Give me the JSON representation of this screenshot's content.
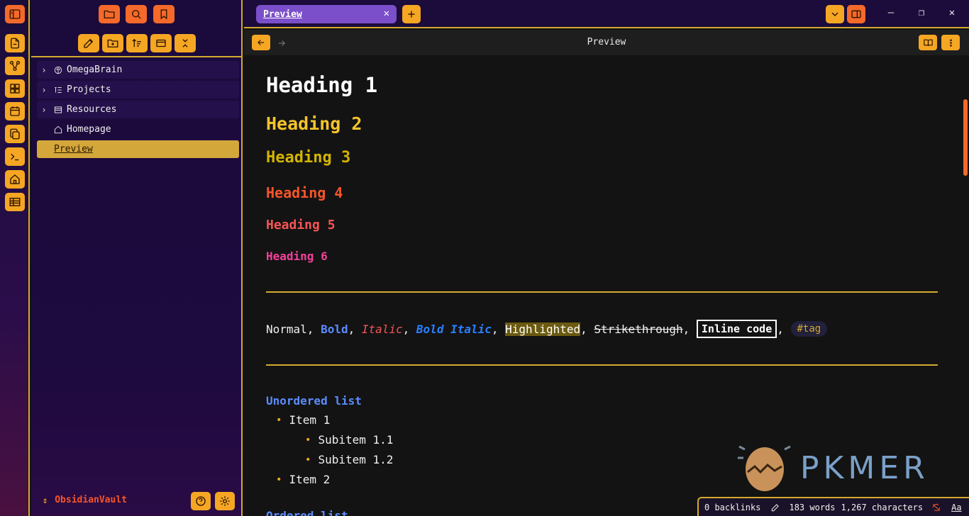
{
  "ribbon": {
    "items": [
      {
        "name": "toggle-sidebar-icon"
      },
      {
        "name": "new-note-icon"
      },
      {
        "name": "graph-view-icon"
      },
      {
        "name": "dashboard-icon"
      },
      {
        "name": "calendar-icon"
      },
      {
        "name": "copy-icon"
      },
      {
        "name": "terminal-icon"
      },
      {
        "name": "home-icon"
      },
      {
        "name": "table-icon"
      }
    ]
  },
  "sidebar": {
    "top_icons": [
      "folder-icon",
      "search-icon",
      "bookmark-icon"
    ],
    "actions": [
      "new-note-icon",
      "new-folder-icon",
      "sort-icon",
      "collapse-view-icon",
      "close-icon"
    ],
    "tree": [
      {
        "label": "OmegaBrain",
        "icon": "brain-icon",
        "expandable": true
      },
      {
        "label": "Projects",
        "icon": "list-tree-icon",
        "expandable": true
      },
      {
        "label": "Resources",
        "icon": "library-icon",
        "expandable": true
      },
      {
        "label": "Homepage",
        "icon": "home-icon",
        "expandable": false
      },
      {
        "label": "Preview",
        "icon": "",
        "expandable": false,
        "active": true
      }
    ],
    "vault_name": "ObsidianVault"
  },
  "tabbar": {
    "active_tab": "Preview"
  },
  "view": {
    "title": "Preview"
  },
  "content": {
    "h1": "Heading 1",
    "h2": "Heading 2",
    "h3": "Heading 3",
    "h4": "Heading 4",
    "h5": "Heading 5",
    "h6": "Heading 6",
    "inline": {
      "normal": "Normal",
      "bold": "Bold",
      "italic": "Italic",
      "bold_italic": "Bold Italic",
      "highlighted": "Highlighted",
      "strikethrough": "Strikethrough",
      "inline_code": "Inline code",
      "tag": "#tag",
      "sep": ", "
    },
    "unordered_title": "Unordered list",
    "items": {
      "item1": "Item 1",
      "sub1": "Subitem 1.1",
      "sub2": "Subitem 1.2",
      "item2": "Item 2"
    },
    "ordered_title": "Ordered list"
  },
  "watermark": "PKMER",
  "status": {
    "backlinks": "0 backlinks",
    "words": "183 words",
    "characters": "1,267 characters",
    "font_toggle": "Aa"
  },
  "colors": {
    "accent": "#f5a623",
    "accent_red": "#f5692a",
    "border": "#d4a92e",
    "tab": "#7b4fc9"
  }
}
